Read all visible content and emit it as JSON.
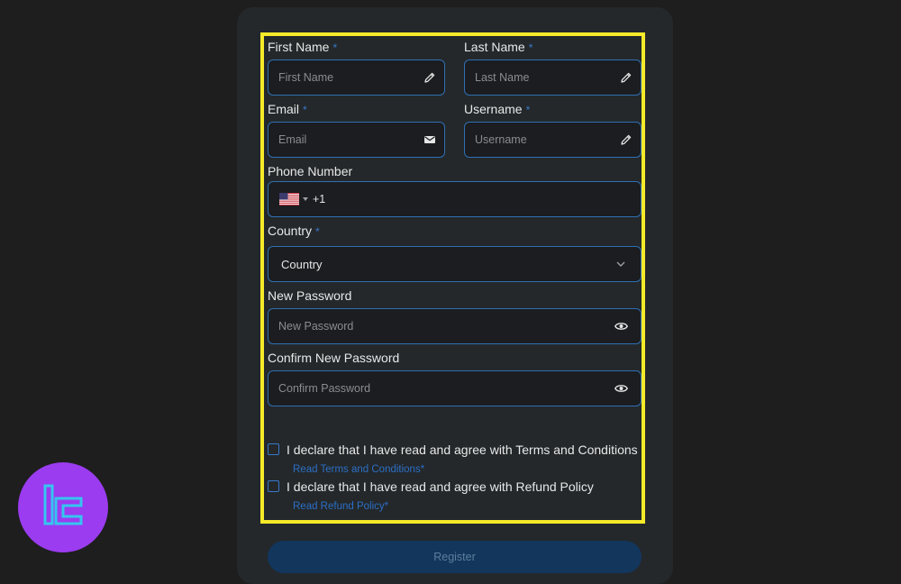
{
  "form": {
    "first_name": {
      "label": "First Name",
      "required": "*",
      "placeholder": "First Name",
      "icon": "pencil-icon"
    },
    "last_name": {
      "label": "Last Name",
      "required": "*",
      "placeholder": "Last Name",
      "icon": "pencil-icon"
    },
    "email": {
      "label": "Email",
      "required": "*",
      "placeholder": "Email",
      "icon": "envelope-icon"
    },
    "username": {
      "label": "Username",
      "required": "*",
      "placeholder": "Username",
      "icon": "pencil-icon"
    },
    "phone": {
      "label": "Phone Number",
      "dial_code": "+1",
      "flag": "us-flag-icon"
    },
    "country": {
      "label": "Country",
      "required": "*",
      "selected": "Country",
      "icon": "chevron-down-icon"
    },
    "new_password": {
      "label": "New Password",
      "placeholder": "New Password",
      "icon": "eye-icon"
    },
    "confirm_password": {
      "label": "Confirm New Password",
      "placeholder": "Confirm Password",
      "icon": "eye-icon"
    },
    "terms": {
      "text": "I declare that I have read and agree with Terms and Conditions",
      "link": "Read Terms and Conditions*"
    },
    "refund": {
      "text": "I declare that I have read and agree with Refund Policy",
      "link": "Read Refund Policy*"
    },
    "register_label": "Register"
  },
  "colors": {
    "background": "#1e1e1e",
    "card": "#24282b",
    "field_border": "#2f6fb2",
    "highlight": "#f5ea2a",
    "link": "#2c6fc5",
    "logo": "#9b3cf0"
  }
}
